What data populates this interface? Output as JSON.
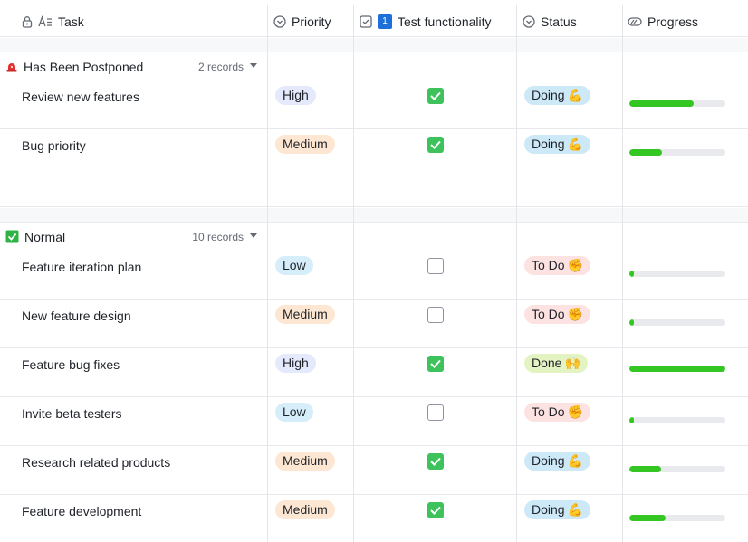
{
  "columns": {
    "task": "Task",
    "priority": "Priority",
    "test": "Test functionality",
    "test_badge": "1",
    "status": "Status",
    "progress": "Progress"
  },
  "colors": {
    "accent_green": "#34c724",
    "checkbox_green": "#3ec25b",
    "high_bg": "#e4e9fb",
    "medium_bg": "#fde6d2",
    "low_bg": "#d6eefa",
    "doing_bg": "#cde9f8",
    "todo_bg": "#fde2e2",
    "done_bg": "#e3f4c2"
  },
  "groups": [
    {
      "title": "Has Been Postponed",
      "count": "2 records",
      "icon": "red-alarm-icon",
      "rows": [
        {
          "task": "Review new features",
          "priority": "High",
          "tested": true,
          "status": "Doing",
          "status_emoji": "💪",
          "progress": 0.67
        },
        {
          "task": "Bug priority",
          "priority": "Medium",
          "tested": true,
          "status": "Doing",
          "status_emoji": "💪",
          "progress": 0.34
        }
      ]
    },
    {
      "title": "Normal",
      "count": "10 records",
      "icon": "green-check-icon",
      "rows": [
        {
          "task": "Feature iteration plan",
          "priority": "Low",
          "tested": false,
          "status": "To Do",
          "status_emoji": "✊",
          "progress": 0.04
        },
        {
          "task": "New feature design",
          "priority": "Medium",
          "tested": false,
          "status": "To Do",
          "status_emoji": "✊",
          "progress": 0.04
        },
        {
          "task": "Feature bug fixes",
          "priority": "High",
          "tested": true,
          "status": "Done",
          "status_emoji": "🙌",
          "progress": 1.0
        },
        {
          "task": "Invite beta testers",
          "priority": "Low",
          "tested": false,
          "status": "To Do",
          "status_emoji": "✊",
          "progress": 0.04
        },
        {
          "task": "Research related products",
          "priority": "Medium",
          "tested": true,
          "status": "Doing",
          "status_emoji": "💪",
          "progress": 0.33
        },
        {
          "task": "Feature development",
          "priority": "Medium",
          "tested": true,
          "status": "Doing",
          "status_emoji": "💪",
          "progress": 0.38
        }
      ]
    }
  ]
}
